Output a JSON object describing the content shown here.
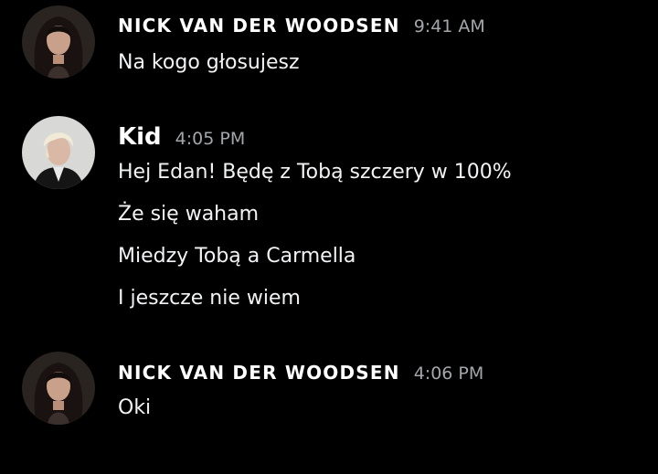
{
  "messages": [
    {
      "author": "NICK VAN DER WOODSEN",
      "time": "9:41 AM",
      "avatar_icon": "user-avatar-dark-hair",
      "lines": [
        "Na kogo głosujesz"
      ]
    },
    {
      "author": "Kid",
      "time": "4:05 PM",
      "avatar_icon": "user-avatar-blond-hair",
      "lines": [
        "Hej Edan! Będę z Tobą szczery w 100%",
        "Że się waham",
        "Miedzy Tobą a Carmella",
        "I jeszcze nie wiem"
      ]
    },
    {
      "author": "NICK VAN DER WOODSEN",
      "time": "4:06 PM",
      "avatar_icon": "user-avatar-dark-hair",
      "lines": [
        "Oki"
      ]
    }
  ],
  "colors": {
    "background": "#000000",
    "text": "#f2f3f5",
    "timestamp": "#a3a6aa"
  }
}
